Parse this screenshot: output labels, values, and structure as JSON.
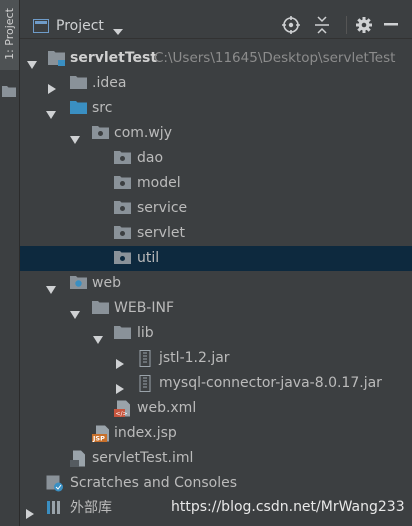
{
  "side_panel": {
    "tab_label": "1: Project"
  },
  "header": {
    "title": "Project"
  },
  "tree": {
    "root": {
      "name": "servletTest",
      "path": "C:\\Users\\11645\\Desktop\\servletTest"
    },
    "idea": ".idea",
    "src": "src",
    "package": "com.wjy",
    "packages": [
      "dao",
      "model",
      "service",
      "servlet",
      "util"
    ],
    "web": "web",
    "webinf": "WEB-INF",
    "lib": "lib",
    "jars": [
      "jstl-1.2.jar",
      "mysql-connector-java-8.0.17.jar"
    ],
    "webxml": "web.xml",
    "jsp": "index.jsp",
    "iml": "servletTest.iml",
    "scratches": "Scratches and Consoles",
    "external": "外部库"
  },
  "watermark": "https://blog.csdn.net/MrWang233",
  "colors": {
    "selection": "#0d293e",
    "background": "#3c3f41",
    "text": "#bbbbbb",
    "folder": "#8a9299",
    "source_folder": "#3a8fc2"
  }
}
